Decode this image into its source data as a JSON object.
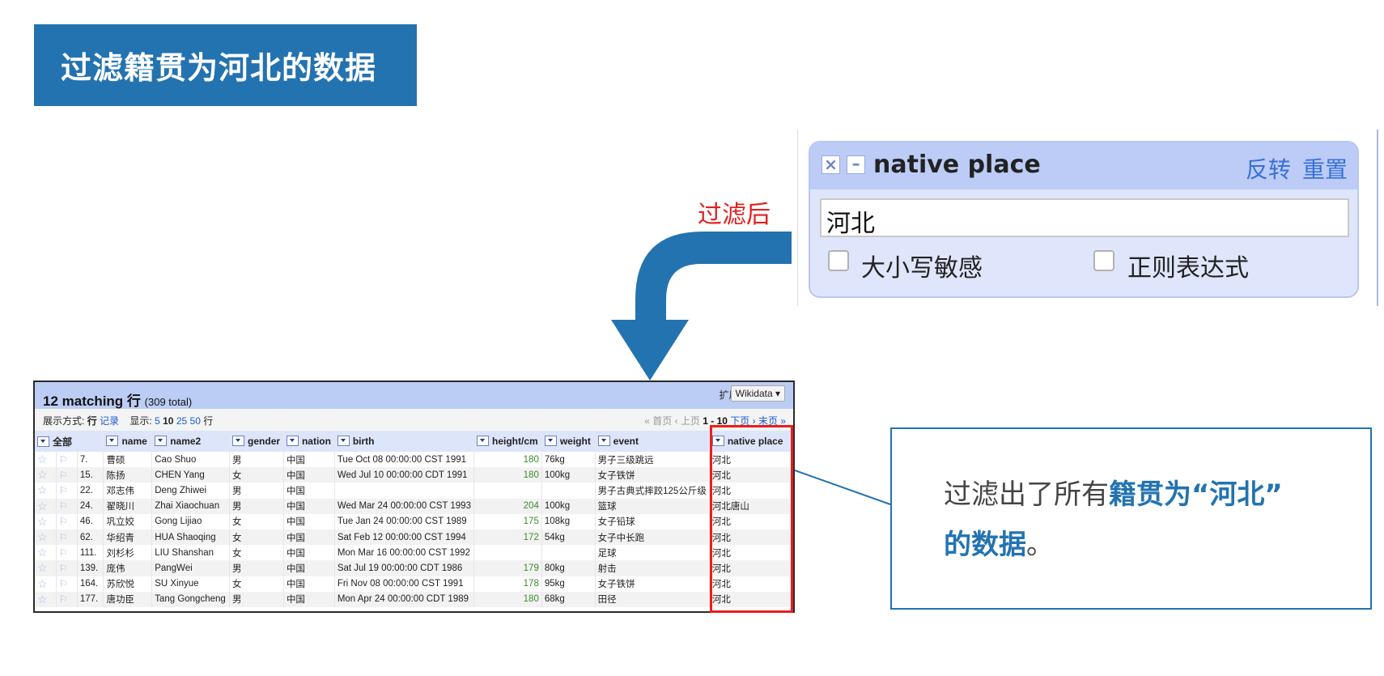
{
  "slide_title": "过滤籍贯为河北的数据",
  "after_label": "过滤后",
  "facet": {
    "title": "native place",
    "invert": "反转",
    "reset": "重置",
    "input_value": "河北",
    "case_sensitive": "大小写敏感",
    "regex": "正则表达式"
  },
  "table": {
    "match_count": "12 matching 行",
    "total": "(309 total)",
    "extension_label": "扩展:",
    "extension_button": "Wikidata ▾",
    "show_as_label": "展示方式:",
    "show_rows": "行",
    "show_records": "记录",
    "show_label": "显示:",
    "page_sizes": [
      "5",
      "10",
      "25",
      "50"
    ],
    "rows_suffix": "行",
    "pager_first": "« 首页",
    "pager_prev": "‹ 上页",
    "pager_range": "1 - 10",
    "pager_next": "下页 ›",
    "pager_last": "末页 »",
    "columns": [
      "全部",
      "name",
      "name2",
      "gender",
      "nation",
      "birth",
      "height/cm",
      "weight",
      "event",
      "native place"
    ],
    "rows": [
      {
        "idx": "7.",
        "name": "曹硕",
        "name2": "Cao Shuo",
        "gender": "男",
        "nation": "中国",
        "birth": "Tue Oct 08 00:00:00 CST 1991",
        "height": "180",
        "weight": "76kg",
        "event": "男子三级跳远",
        "native": "河北"
      },
      {
        "idx": "15.",
        "name": "陈扬",
        "name2": "CHEN Yang",
        "gender": "女",
        "nation": "中国",
        "birth": "Wed Jul 10 00:00:00 CDT 1991",
        "height": "180",
        "weight": "100kg",
        "event": "女子铁饼",
        "native": "河北"
      },
      {
        "idx": "22.",
        "name": "邓志伟",
        "name2": "Deng Zhiwei",
        "gender": "男",
        "nation": "中国",
        "birth": "",
        "height": "",
        "weight": "",
        "event": "男子古典式摔跤125公斤级",
        "native": "河北"
      },
      {
        "idx": "24.",
        "name": "翟晓川",
        "name2": "Zhai Xiaochuan",
        "gender": "男",
        "nation": "中国",
        "birth": "Wed Mar 24 00:00:00 CST 1993",
        "height": "204",
        "weight": "100kg",
        "event": "篮球",
        "native": "河北唐山"
      },
      {
        "idx": "46.",
        "name": "巩立姣",
        "name2": "Gong Lijiao",
        "gender": "女",
        "nation": "中国",
        "birth": "Tue Jan 24 00:00:00 CST 1989",
        "height": "175",
        "weight": "108kg",
        "event": "女子铅球",
        "native": "河北"
      },
      {
        "idx": "62.",
        "name": "华绍青",
        "name2": "HUA Shaoqing",
        "gender": "女",
        "nation": "中国",
        "birth": "Sat Feb 12 00:00:00 CST 1994",
        "height": "172",
        "weight": "54kg",
        "event": "女子中长跑",
        "native": "河北"
      },
      {
        "idx": "111.",
        "name": "刘杉杉",
        "name2": "LIU Shanshan",
        "gender": "女",
        "nation": "中国",
        "birth": "Mon Mar 16 00:00:00 CST 1992",
        "height": "",
        "weight": "",
        "event": "足球",
        "native": "河北"
      },
      {
        "idx": "139.",
        "name": "庞伟",
        "name2": "PangWei",
        "gender": "男",
        "nation": "中国",
        "birth": "Sat Jul 19 00:00:00 CDT 1986",
        "height": "179",
        "weight": "80kg",
        "event": "射击",
        "native": "河北"
      },
      {
        "idx": "164.",
        "name": "苏欣悦",
        "name2": "SU Xinyue",
        "gender": "女",
        "nation": "中国",
        "birth": "Fri Nov 08 00:00:00 CST 1991",
        "height": "178",
        "weight": "95kg",
        "event": "女子铁饼",
        "native": "河北"
      },
      {
        "idx": "177.",
        "name": "唐功臣",
        "name2": "Tang Gongcheng",
        "gender": "男",
        "nation": "中国",
        "birth": "Mon Apr 24 00:00:00 CDT 1989",
        "height": "180",
        "weight": "68kg",
        "event": "田径",
        "native": "河北"
      }
    ]
  },
  "callout": {
    "part1": "过滤出了所有",
    "part2": "籍贯为“河北”",
    "part3": "的数据",
    "part4": "。"
  },
  "colors": {
    "accent": "#2373b0",
    "highlight_red": "#ee1c1c",
    "facet_bg": "#dfe6fb"
  }
}
